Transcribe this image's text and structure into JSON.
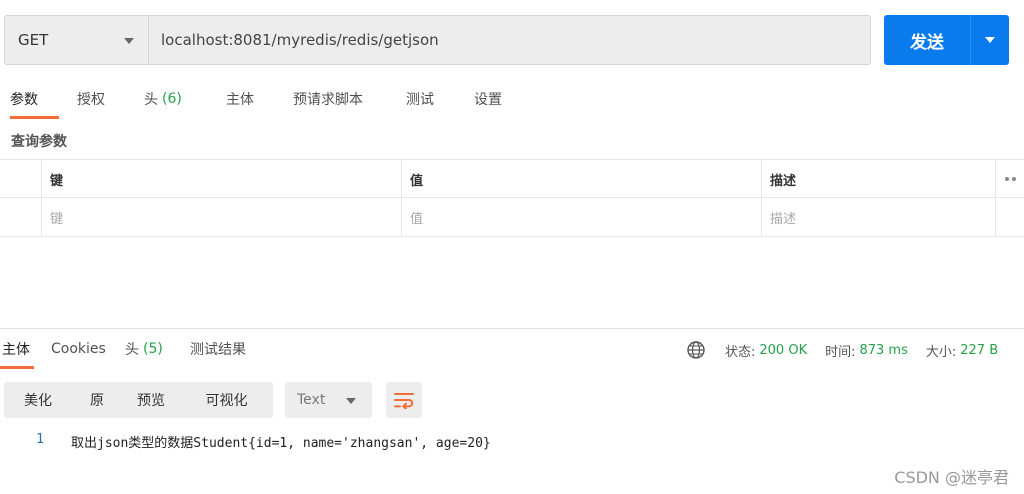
{
  "request": {
    "method": "GET",
    "url": "localhost:8081/myredis/redis/getjson",
    "send_label": "发送"
  },
  "request_tabs": [
    {
      "label": "参数",
      "active": true
    },
    {
      "label": "授权"
    },
    {
      "label": "头",
      "count": "(6)"
    },
    {
      "label": "主体"
    },
    {
      "label": "预请求脚本"
    },
    {
      "label": "测试"
    },
    {
      "label": "设置"
    }
  ],
  "query_params": {
    "section_label": "查询参数",
    "headers": {
      "key": "键",
      "value": "值",
      "description": "描述"
    },
    "placeholders": {
      "key": "键",
      "value": "值",
      "description": "描述"
    }
  },
  "response_tabs": [
    {
      "label": "主体",
      "active": true
    },
    {
      "label": "Cookies"
    },
    {
      "label": "头",
      "count": "(5)"
    },
    {
      "label": "测试结果"
    }
  ],
  "response_status": {
    "status_label": "状态:",
    "status_value": "200 OK",
    "time_label": "时间:",
    "time_value": "873 ms",
    "size_label": "大小:",
    "size_value": "227 B"
  },
  "response_toolbar": {
    "view_modes": [
      "美化",
      "原",
      "预览",
      "可视化"
    ],
    "format": "Text"
  },
  "response_body": {
    "lines": [
      {
        "number": "1",
        "text": "取出json类型的数据Student{id=1, name='zhangsan', age=20}"
      }
    ]
  },
  "watermark": "CSDN @迷亭君",
  "colors": {
    "accent": "#f26b3a",
    "send_button": "#097bed",
    "success": "#26a14b"
  }
}
